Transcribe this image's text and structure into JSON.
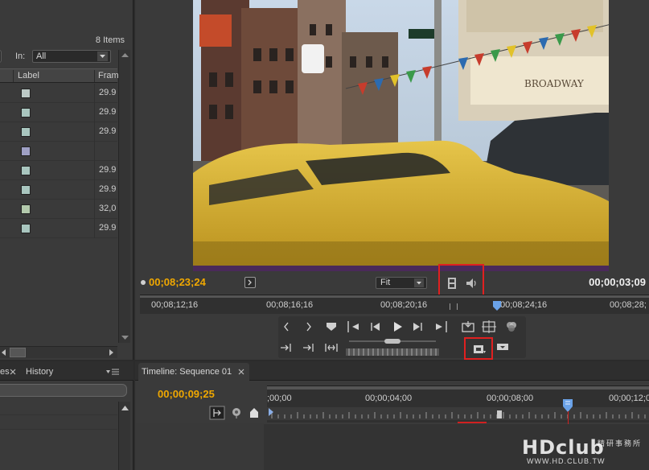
{
  "project_panel": {
    "items_count": "8 Items",
    "in_label": "In:",
    "in_filter_value": "All",
    "columns": [
      "Label",
      "Fram"
    ],
    "rows": [
      {
        "label_color": "#bcc9c6",
        "frame_rate": "29.9"
      },
      {
        "label_color": "#a9c6bf",
        "frame_rate": "29.9"
      },
      {
        "label_color": "#a9c6bf",
        "frame_rate": "29.9"
      },
      {
        "label_color": "#9fa0c4",
        "frame_rate": ""
      },
      {
        "label_color": "#a9c6bf",
        "frame_rate": "29.9"
      },
      {
        "label_color": "#a9c6bf",
        "frame_rate": "29.9"
      },
      {
        "label_color": "#b3c9ac",
        "frame_rate": "32,0"
      },
      {
        "label_color": "#a9c6bf",
        "frame_rate": "29.9"
      }
    ]
  },
  "program_monitor": {
    "playhead_timecode": "00;08;23;24",
    "zoom_level": "Fit",
    "duration_timecode": "00;00;03;09",
    "ruler_ticks": [
      "00;08;12;16",
      "00;08;16;16",
      "00;08;20;16",
      "00;08;24;16",
      "00;08;28;"
    ],
    "controls": [
      "step-back",
      "step-forward",
      "set-marker",
      "go-to-in",
      "step-back-frame",
      "play",
      "step-forward-frame",
      "go-to-out",
      "export-frame",
      "safe-margins",
      "output",
      "insert",
      "overlay",
      "lift",
      "extract",
      "trim"
    ]
  },
  "history_panel": {
    "tab_partial": "es",
    "tab_history": "History"
  },
  "timeline": {
    "tab_title": "Timeline: Sequence 01",
    "timecode": "00;00;09;25",
    "ruler_ticks": [
      ";00;00",
      "00;00;04;00",
      "00;00;08;00",
      "00;00;12;0"
    ]
  },
  "watermark": {
    "logo": "HDclub",
    "chinese": "精研事務所",
    "url": "WWW.HD.CLUB.TW"
  },
  "colors": {
    "timecode_accent": "#f0a800",
    "highlight": "#e02020",
    "panel_bg": "#3a3a3a"
  }
}
